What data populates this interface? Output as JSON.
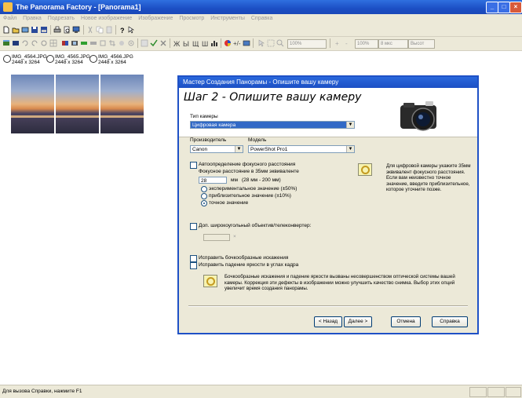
{
  "window": {
    "title": "The Panorama Factory - [Panorama1]",
    "controls": [
      "_",
      "□",
      "×"
    ]
  },
  "menu": [
    "Файл",
    "Правка",
    "Подрезать",
    "Новое изображение",
    "Изображение",
    "Просмотр",
    "Инструменты",
    "Справка"
  ],
  "toolbar2": {
    "zoom": "100%",
    "val1": "100%",
    "val2": "8 мкс",
    "val3": "Высот"
  },
  "thumbs": [
    {
      "name": "IMG_4564.JPG",
      "size": "2448 x 3264"
    },
    {
      "name": "IMG_4565.JPG",
      "size": "2448 x 3264"
    },
    {
      "name": "IMG_4566.JPG",
      "size": "2448 x 3264"
    }
  ],
  "status": {
    "text": "Для вызова Справки, нажмите F1"
  },
  "dialog": {
    "title": "Мастер Создания Панорамы - Опишите вашу камеру",
    "heading": "Шаг 2 - Опишите вашу камеру",
    "camera_type_label": "Тип камеры",
    "camera_type_value": "Цифровая камера",
    "maker_label": "Производитель",
    "maker_value": "Canon",
    "model_label": "Модель",
    "model_value": "PowerShot Pro1",
    "autodetect_label": "Автоопределение фокусного расстояния",
    "focal_label": "Фокусное расстояние в 35мм эквиваленте",
    "focal_value": "28",
    "focal_unit": "мм",
    "focal_range": "(28 мм - 200 мм)",
    "radio1": "экспериментальное значение (±50%)",
    "radio2": "приблизительное значение (±10%)",
    "radio3": "точное значение",
    "hint1": "Для цифровой камеры укажите 35мм эквивалент фокусного расстояния. Если вам неизвестно точное значение, введите приблизительное, которое уточните позже.",
    "converter_label": "Доп. широкоугольный объектив/телеконвертер:",
    "converter_mult": "×",
    "barrel_label": "Исправить бочкообразные искажения",
    "vignette_label": "Исправить падение яркости в углах кадра",
    "hint2": "Бочкообразные искажения и падение яркости вызваны несовершенством оптической системы вашей камеры. Коррекция эти дефекты в изображении можно улучшить качество снимка. Выбор этих опций увеличит время создания панорамы.",
    "btn_back": "< Назад",
    "btn_next": "Далее >",
    "btn_cancel": "Отмена",
    "btn_help": "Справка"
  }
}
